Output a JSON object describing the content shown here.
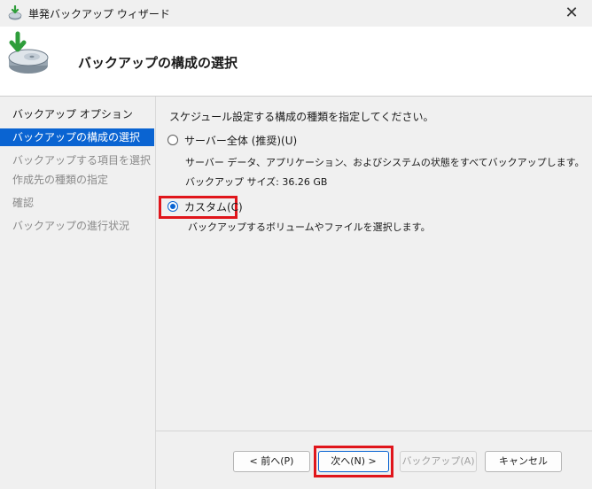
{
  "window": {
    "title": "単発バックアップ ウィザード",
    "close_symbol": "✕",
    "app_icon": "backup-wizard-icon"
  },
  "header": {
    "page_title": "バックアップの構成の選択",
    "hero_icon": "disk-backup-icon"
  },
  "sidebar": {
    "items": [
      {
        "label": "バックアップ オプション",
        "state": "done"
      },
      {
        "label": "バックアップの構成の選択",
        "state": "active"
      },
      {
        "label": "バックアップする項目を選択",
        "state": "pending"
      },
      {
        "label": "作成先の種類の指定",
        "state": "pending"
      },
      {
        "label": "確認",
        "state": "pending"
      },
      {
        "label": "バックアップの進行状況",
        "state": "pending"
      }
    ]
  },
  "main": {
    "instruction": "スケジュール設定する構成の種類を指定してください。",
    "options": [
      {
        "label": "サーバー全体 (推奨)(U)",
        "selected": false,
        "description": "サーバー データ、アプリケーション、およびシステムの状態をすべてバックアップします。",
        "detail": "バックアップ サイズ: 36.26 GB"
      },
      {
        "label": "カスタム(C)",
        "selected": true,
        "description": "バックアップするボリュームやファイルを選択します。"
      }
    ]
  },
  "footer": {
    "back_label": "< 前へ(P)",
    "next_label": "次へ(N) >",
    "backup_label": "バックアップ(A)",
    "cancel_label": "キャンセル"
  },
  "colors": {
    "accent": "#0a64d2",
    "highlight": "#e0151b"
  }
}
